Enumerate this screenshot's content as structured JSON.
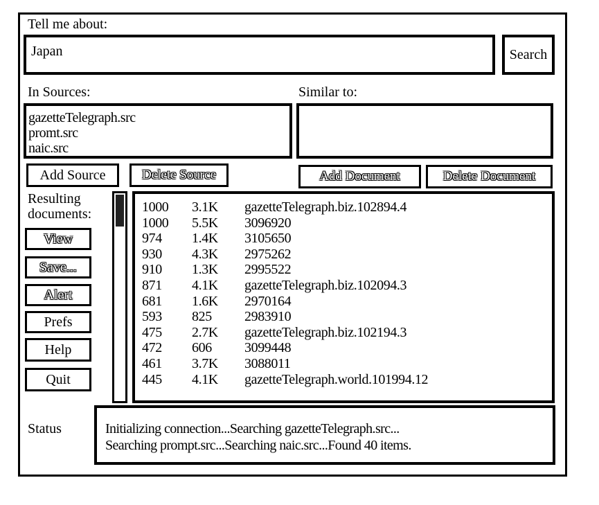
{
  "query": {
    "label": "Tell me about:",
    "value": "Japan",
    "search_label": "Search"
  },
  "sources": {
    "label": "In Sources:",
    "items": [
      "gazetteTelegraph.src",
      "promt.src",
      "naic.src"
    ],
    "add_label": "Add Source",
    "delete_label": "Delete Source"
  },
  "similar": {
    "label": "Similar to:",
    "add_label": "Add Document",
    "delete_label": "Delete Document"
  },
  "results": {
    "label_line1": "Resulting",
    "label_line2": "documents:",
    "rows": [
      {
        "score": "1000",
        "size": "3.1K",
        "name": "gazetteTelegraph.biz.102894.4"
      },
      {
        "score": "1000",
        "size": "5.5K",
        "name": "3096920"
      },
      {
        "score": "974",
        "size": "1.4K",
        "name": "3105650"
      },
      {
        "score": "930",
        "size": "4.3K",
        "name": "2975262"
      },
      {
        "score": "910",
        "size": "1.3K",
        "name": "2995522"
      },
      {
        "score": "871",
        "size": "4.1K",
        "name": "gazetteTelegraph.biz.102094.3"
      },
      {
        "score": "681",
        "size": "1.6K",
        "name": "2970164"
      },
      {
        "score": "593",
        "size": "825",
        "name": "2983910"
      },
      {
        "score": "475",
        "size": "2.7K",
        "name": "gazetteTelegraph.biz.102194.3"
      },
      {
        "score": "472",
        "size": "606",
        "name": "3099448"
      },
      {
        "score": "461",
        "size": "3.7K",
        "name": "3088011"
      },
      {
        "score": "445",
        "size": "4.1K",
        "name": "gazetteTelegraph.world.101994.12"
      }
    ]
  },
  "actions": {
    "view": "View",
    "save": "Save...",
    "alert": "Alert",
    "prefs": "Prefs",
    "help": "Help",
    "quit": "Quit"
  },
  "status": {
    "label": "Status",
    "line1": "Initializing connection...Searching gazetteTelegraph.src...",
    "line2": "Searching prompt.src...Searching naic.src...Found 40 items."
  }
}
